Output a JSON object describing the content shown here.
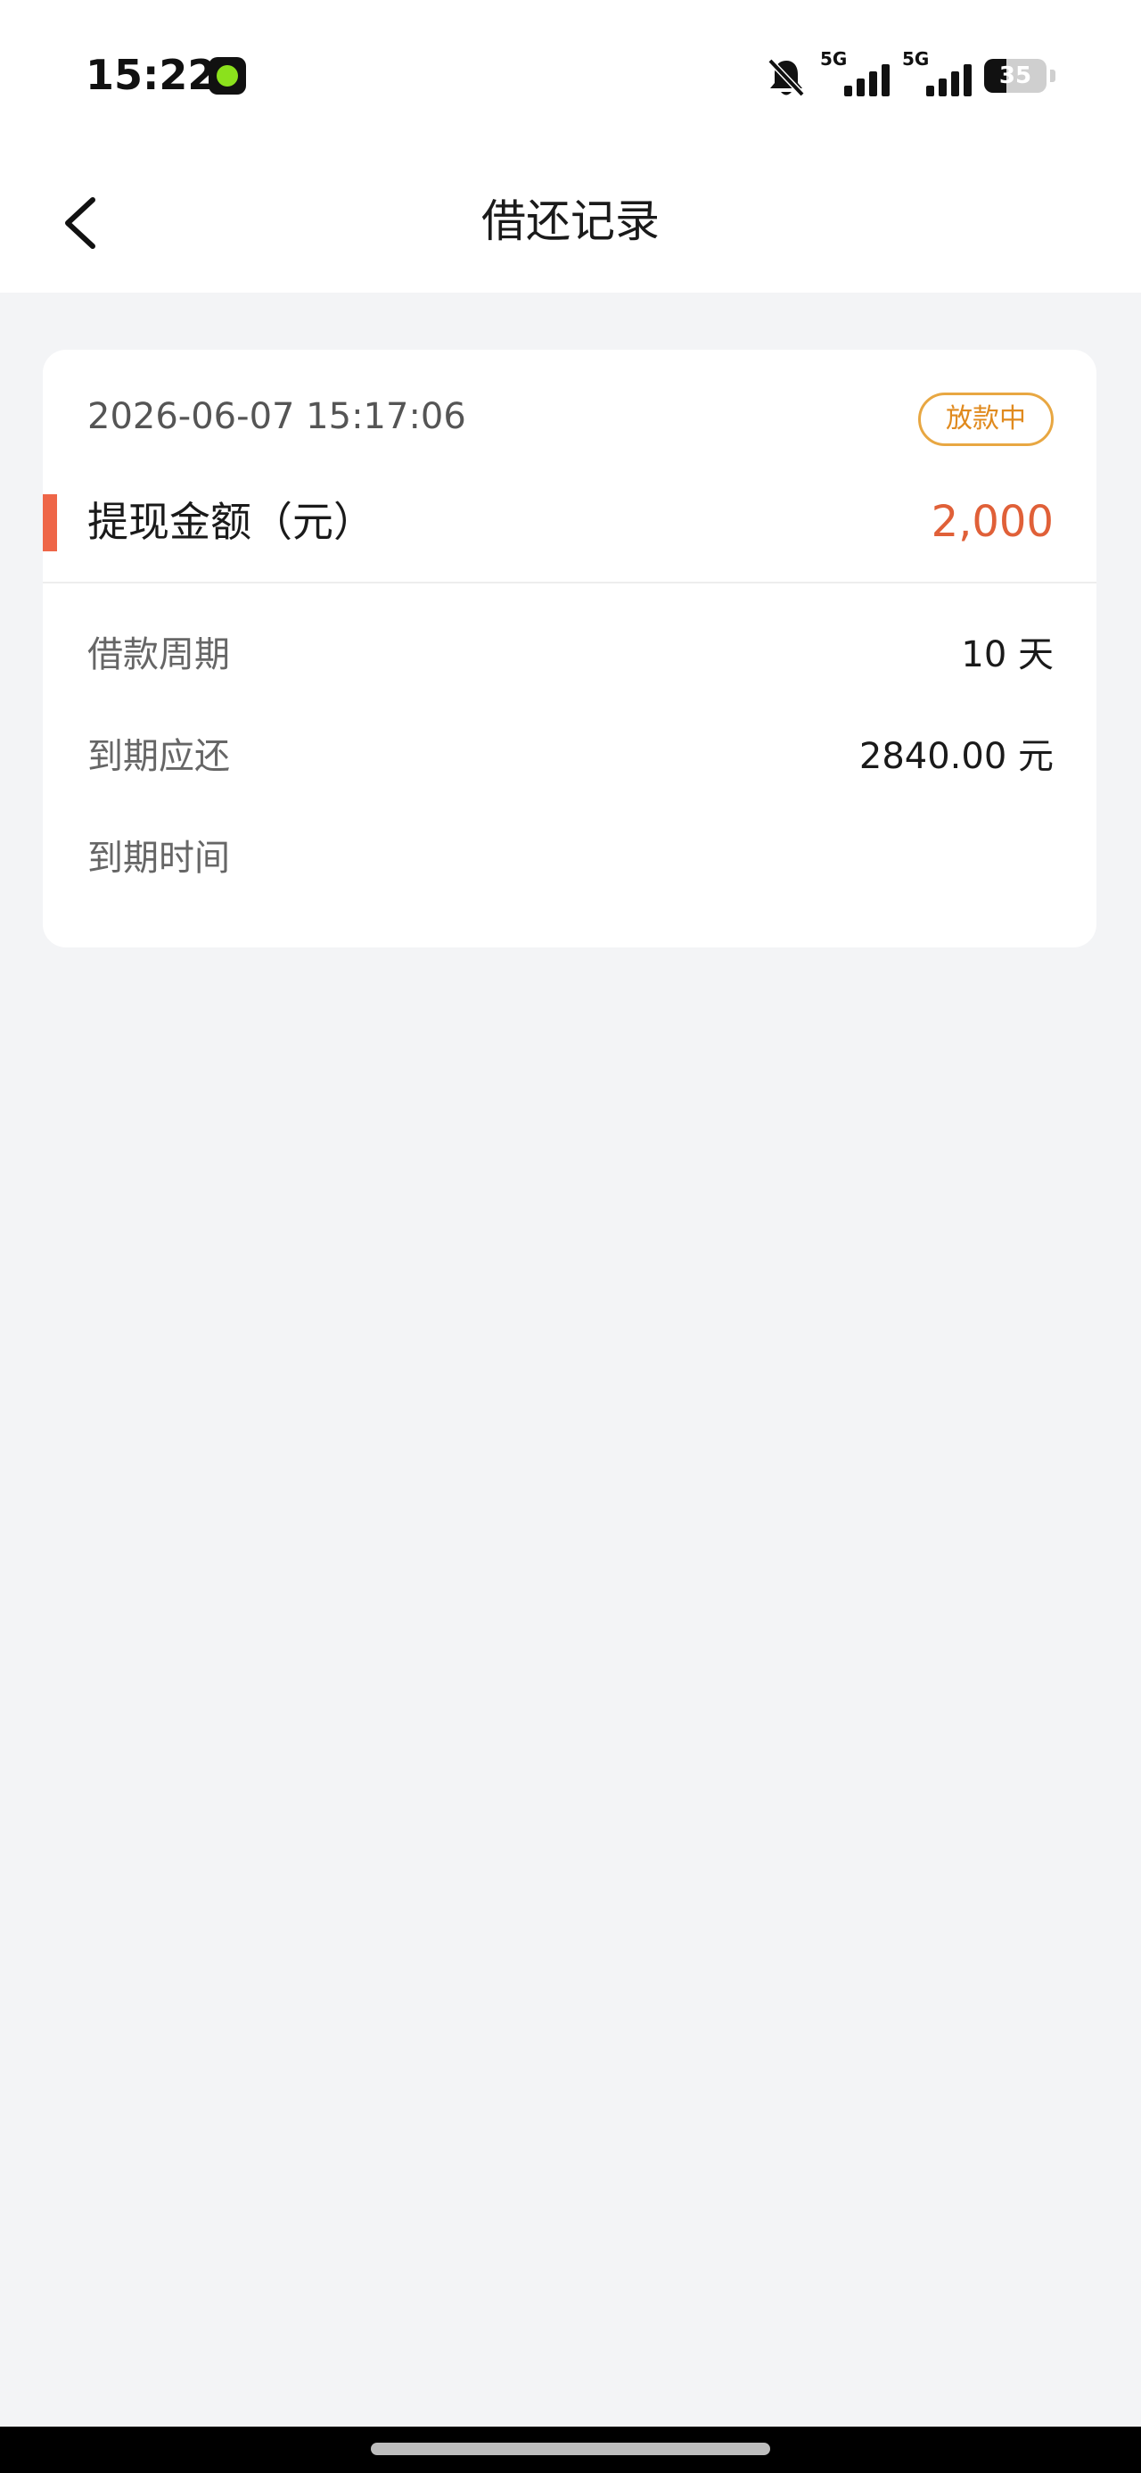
{
  "status_bar": {
    "time": "15:22",
    "network_1": "5G",
    "network_2": "5G",
    "battery": "35",
    "battery_level": 0.35
  },
  "nav": {
    "title": "借还记录"
  },
  "record": {
    "date": "2026-06-07 15:17:06",
    "status": "放款中",
    "amount_label": "提现金额（元）",
    "amount_value": "2,000",
    "rows": [
      {
        "label": "借款周期",
        "value": "10 天"
      },
      {
        "label": "到期应还",
        "value": "2840.00 元"
      },
      {
        "label": "到期时间",
        "value": ""
      }
    ]
  },
  "colors": {
    "accent": "#EE6648",
    "amount": "#E06038",
    "badge": "#E08A1E",
    "background": "#F3F4F6"
  }
}
